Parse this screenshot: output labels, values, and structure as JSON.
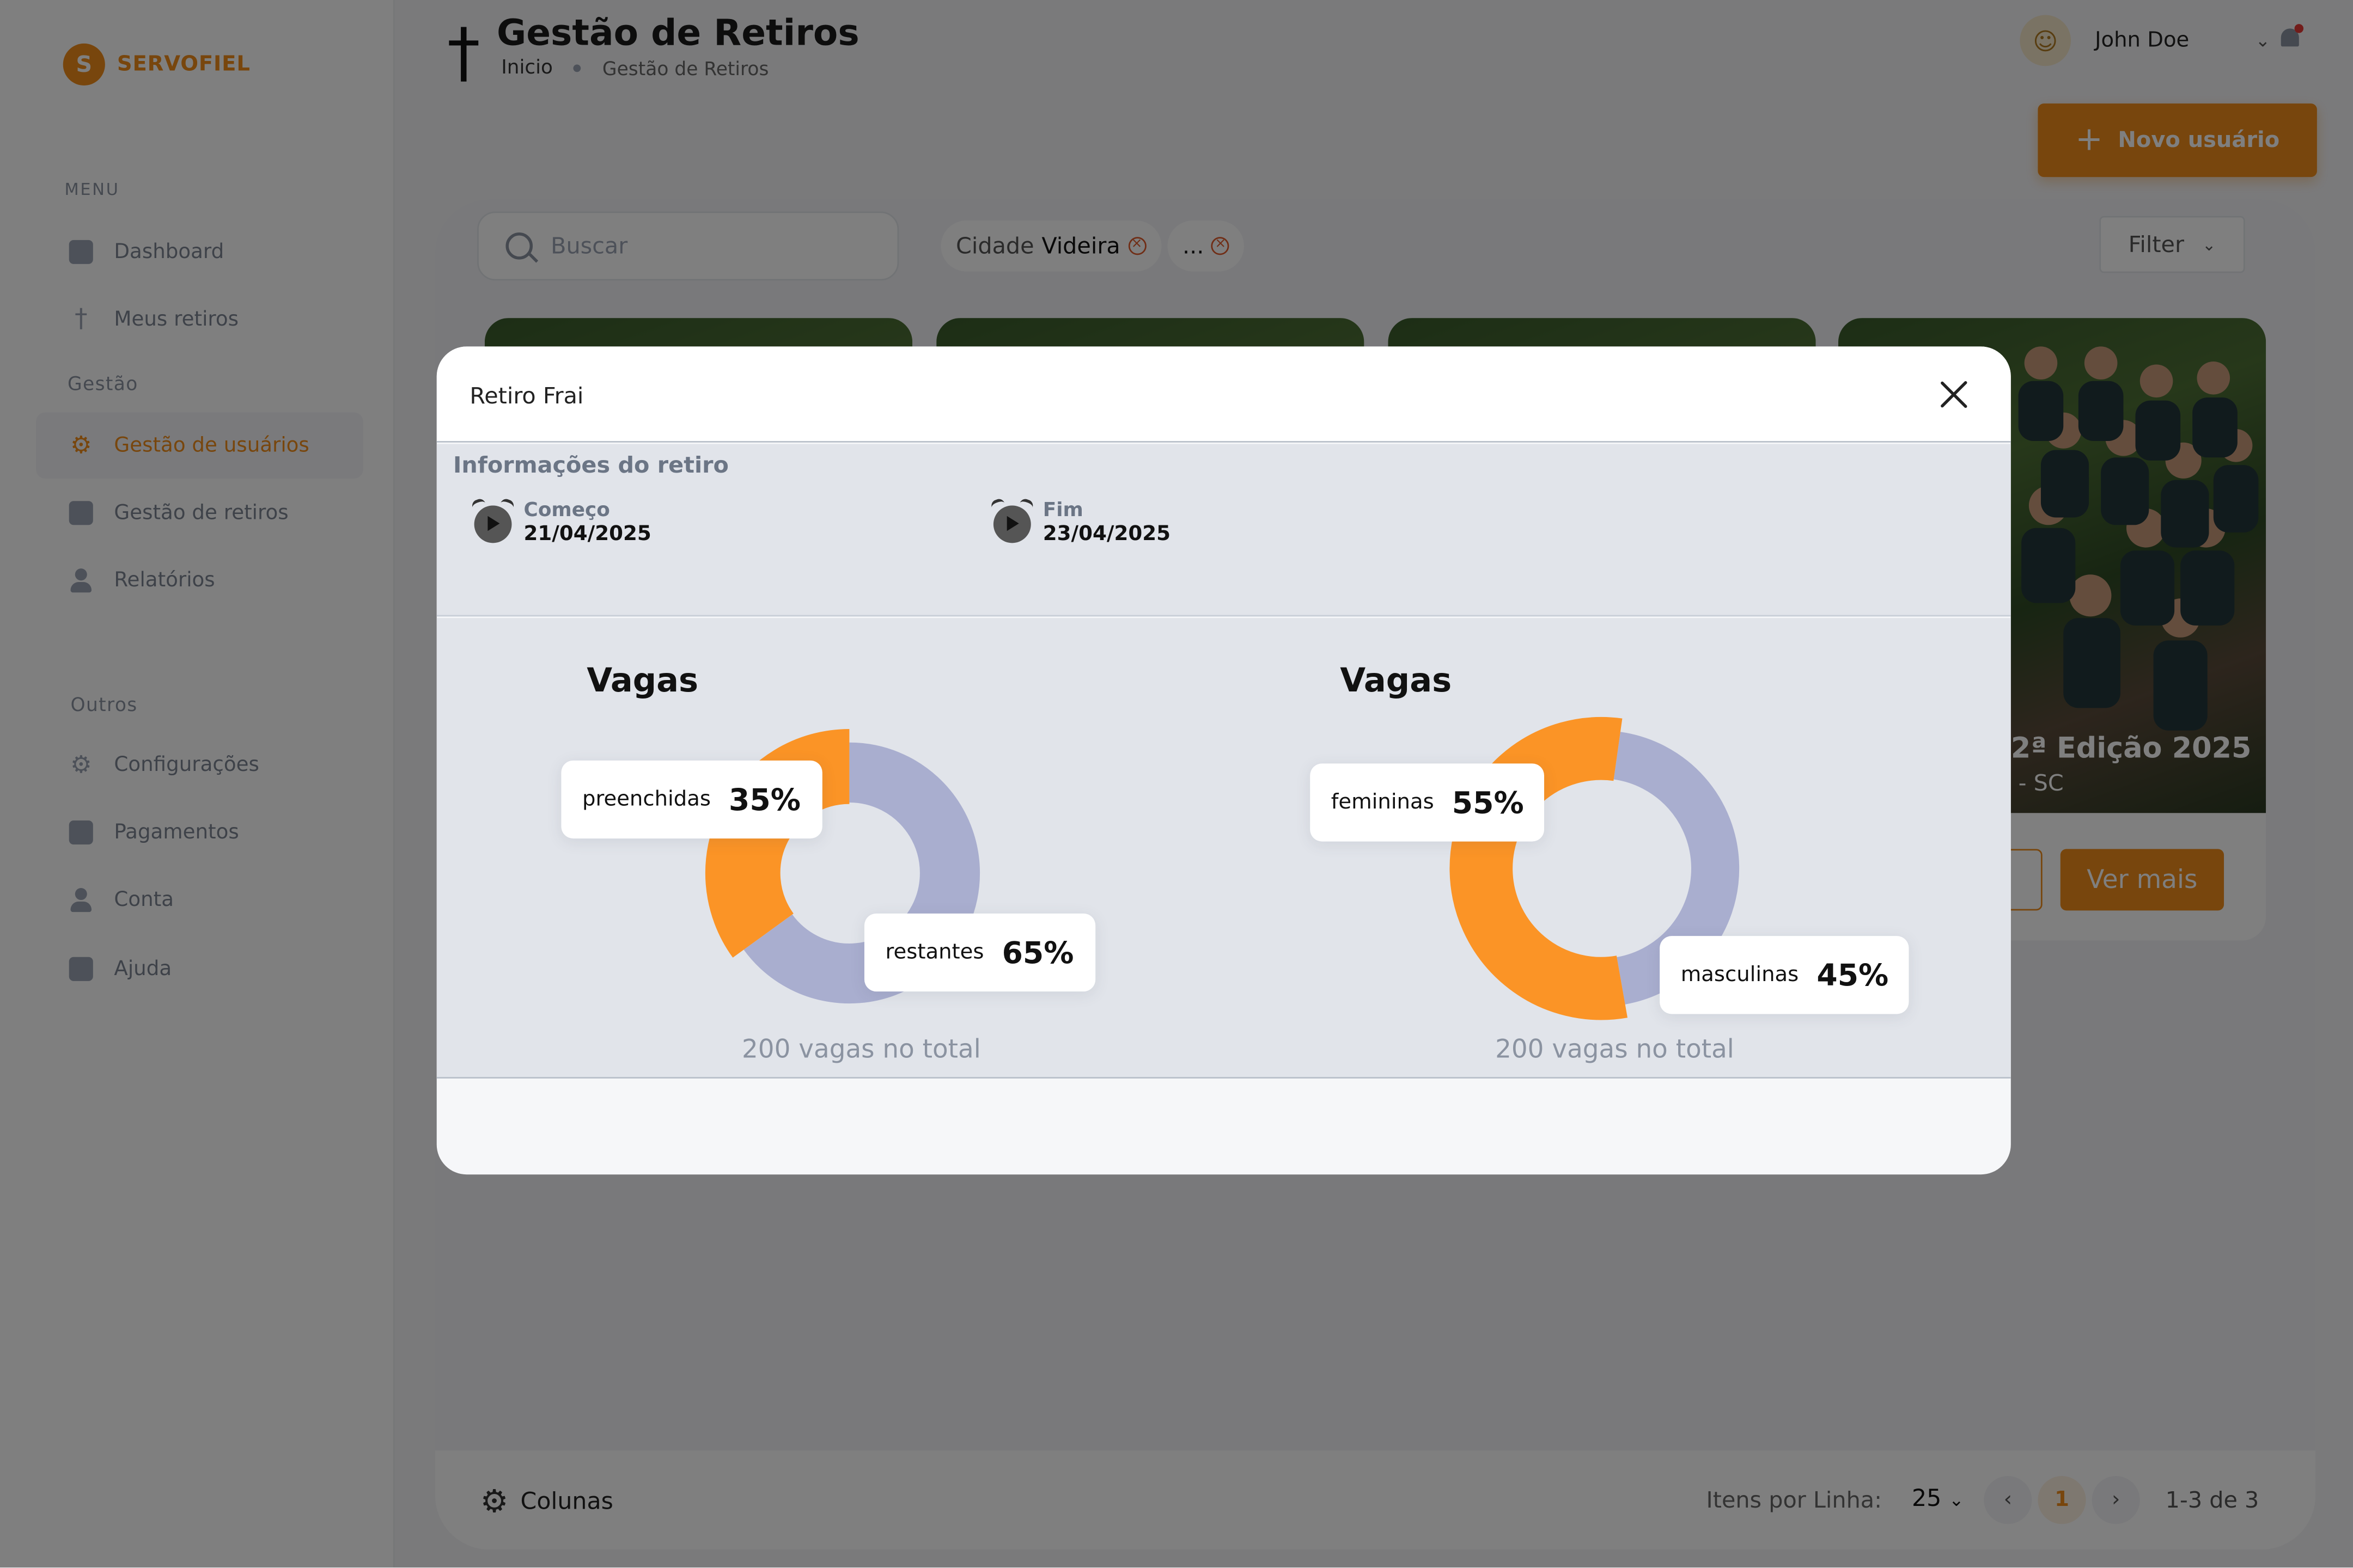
{
  "brand": {
    "name": "SERVOFIEL",
    "mark": "S"
  },
  "sidebar": {
    "menu_label": "MENU",
    "items": [
      {
        "label": "Dashboard"
      },
      {
        "label": "Meus retiros"
      }
    ],
    "gestao_label": "Gestão",
    "gestao_items": [
      {
        "label": "Gestão de usuários",
        "active": true
      },
      {
        "label": "Gestão de retiros"
      },
      {
        "label": "Relatórios"
      }
    ],
    "outros_label": "Outros",
    "outros_items": [
      {
        "label": "Configurações"
      },
      {
        "label": "Pagamentos"
      },
      {
        "label": "Conta"
      },
      {
        "label": "Ajuda"
      }
    ]
  },
  "header": {
    "title": "Gestão de Retiros",
    "breadcrumb": [
      "Inicio",
      "Gestão de Retiros"
    ],
    "user_name": "John Doe",
    "new_user_label": "Novo usuário"
  },
  "toolbar": {
    "search_placeholder": "Buscar",
    "chips": [
      {
        "key": "Cidade",
        "value": "Videira"
      },
      {
        "key": "",
        "value": "..."
      }
    ],
    "filter_label": "Filter"
  },
  "cards": [
    {
      "title": "2ª Edição 2025",
      "subtitle": "- SC",
      "more_label": "Ver mais"
    }
  ],
  "footer": {
    "columns_label": "Colunas",
    "items_per_row_label": "Itens por Linha:",
    "items_per_row_value": "25",
    "current_page": "1",
    "range": "1-3 de 3"
  },
  "modal": {
    "title": "Retiro Frai",
    "info_heading": "Informações do retiro",
    "start_label": "Começo",
    "start_date": "21/04/2025",
    "end_label": "Fim",
    "end_date": "23/04/2025"
  },
  "colors": {
    "accent": "#f08c1a",
    "donut_orange": "#fb9426",
    "donut_grey": "#a9aecf"
  },
  "chart_data": [
    {
      "type": "pie",
      "title": "Vagas",
      "categories": [
        "preenchidas",
        "restantes"
      ],
      "values": [
        35,
        65
      ],
      "labels": [
        "35%",
        "65%"
      ],
      "colors": [
        "#fb9426",
        "#a9aecf"
      ],
      "total_note": "200 vagas no total"
    },
    {
      "type": "pie",
      "title": "Vagas",
      "categories": [
        "femininas",
        "masculinas"
      ],
      "values": [
        55,
        45
      ],
      "labels": [
        "55%",
        "45%"
      ],
      "colors": [
        "#fb9426",
        "#a9aecf"
      ],
      "total_note": "200 vagas no total"
    }
  ]
}
